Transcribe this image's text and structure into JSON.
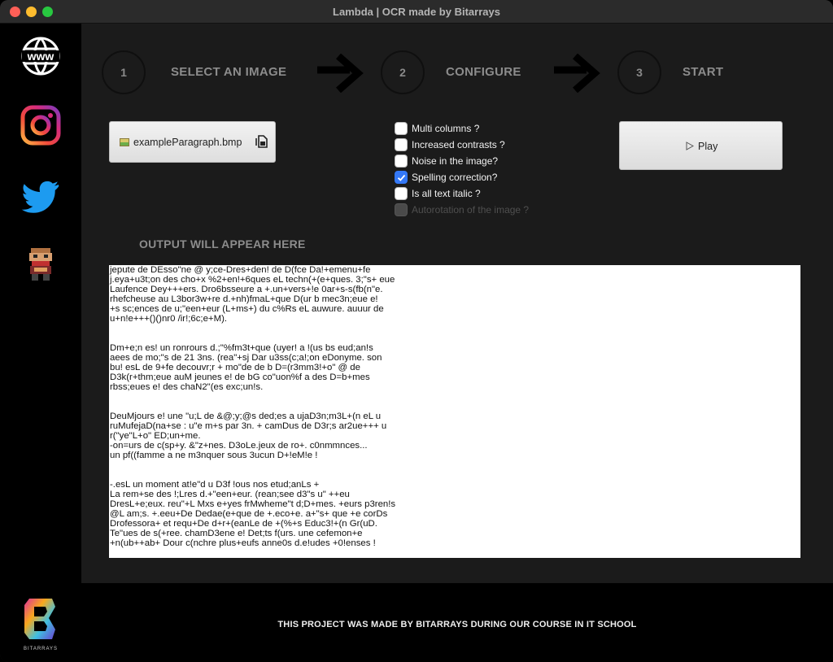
{
  "window": {
    "title": "Lambda | OCR made by Bitarrays"
  },
  "sidebar": {
    "items": [
      {
        "name": "www",
        "icon": "globe-www-icon"
      },
      {
        "name": "instagram",
        "icon": "instagram-icon"
      },
      {
        "name": "twitter",
        "icon": "twitter-icon"
      },
      {
        "name": "game",
        "icon": "pixel-character-icon"
      }
    ],
    "brand": {
      "icon": "bitarrays-logo",
      "label": "BITARRAYS"
    }
  },
  "steps": [
    {
      "number": "1",
      "label": "SELECT AN IMAGE"
    },
    {
      "number": "2",
      "label": "CONFIGURE"
    },
    {
      "number": "3",
      "label": "START"
    }
  ],
  "file": {
    "name": "exampleParagraph.bmp",
    "icon": "bmp-file-icon",
    "action_icon": "document-icon"
  },
  "options": [
    {
      "label": "Multi columns ?",
      "checked": false,
      "disabled": false
    },
    {
      "label": "Increased contrasts ?",
      "checked": false,
      "disabled": false
    },
    {
      "label": "Noise in the image?",
      "checked": false,
      "disabled": false
    },
    {
      "label": "Spelling correction?",
      "checked": true,
      "disabled": false
    },
    {
      "label": "Is all text italic ?",
      "checked": false,
      "disabled": false
    },
    {
      "label": "Autorotation of the image ?",
      "checked": false,
      "disabled": true
    }
  ],
  "play": {
    "label": "Play",
    "icon": "play-icon"
  },
  "output": {
    "heading": "OUTPUT WILL APPEAR HERE",
    "text": "jepute de DEsso\"ne @ y;ce-Dres+den! de D(fce Da!+emenu+fe\nj.eya+u3t;on des cho+x %2+en!+6ques eL techn(+(e+ques. 3;\"s+ eue\nLaufence Dey+++ers. Dro6bsseure a +.un+vers+!e 0ar+s-s(fb(n\"e.\nrhefcheuse au L3bor3w+re d.+nh)fmaL+que D(ur b mec3n;eue e!\n+s sc;ences de u;\"een+eur (L+ms+) du c%Rs eL auwure. auuur de\nu+n!e+++()()nr0 /ir!;6c;e+M).\n\n\nDm+e;n es! un ronrours d.;\"%fm3t+que (uyer! a !(us bs eud;an!s\naees de mo;\"s de 21 3ns. (rea\"+sj Dar u3ss(c;a!;on eDonyme. son\nbu! esL de 9+fe decouvr;r + mo\"de de b D=(r3mm3!+o\" @ de\nD3k(r+thm;eue auM jeunes e! de bG co\"uon%f a des D=b+mes\nrbss;eues e! des chaN2\"(es exc;un!s.\n\n\nDeuMjours e! une \"u;L de &@;y;@s ded;es a ujaD3n;m3L+(n eL u\nruMufejaD(na+se : u\"e m+s par 3n. + camDus de D3r;s ar2ue+++ u\nr(\"ye\"L+o\" ED;un+me.\n-on=urs de c(sp+y. &\"z+nes. D3oLe.jeux de ro+. c0nmmnces...\nun pf((famme a ne m3nquer sous 3ucun D+!eM!e !\n\n\n-.esL un moment at!e\"d u D3f !ous nos etud;anLs +\nLa rem+se des !;Lres d.+\"een+eur. (rean;see d3\"s u\" ++eu\nDresL+e;eux. reu\"+L Mxs e+yes frMwheme\"t d;D+mes. +eurs p3ren!s\n@L am;s. +.eeu+De Dedae(e+que de +.eco+e. a+\"s+ que +e corDs\nDrofessora+ et requ+De d+r+(eanLe de +(%+s Educ3!+(n Gr(uD.\nTe\"ues de s(+ree. chamD3ene e! Det;ts f(urs. une cefemon+e\n+n(ub++ab+ Dour c(nchre plus+eufs anne0s d.e!udes +0!enses !"
  },
  "footer": {
    "text": "THIS PROJECT WAS MADE BY BITARRAYS DURING OUR COURSE IN IT SCHOOL"
  }
}
